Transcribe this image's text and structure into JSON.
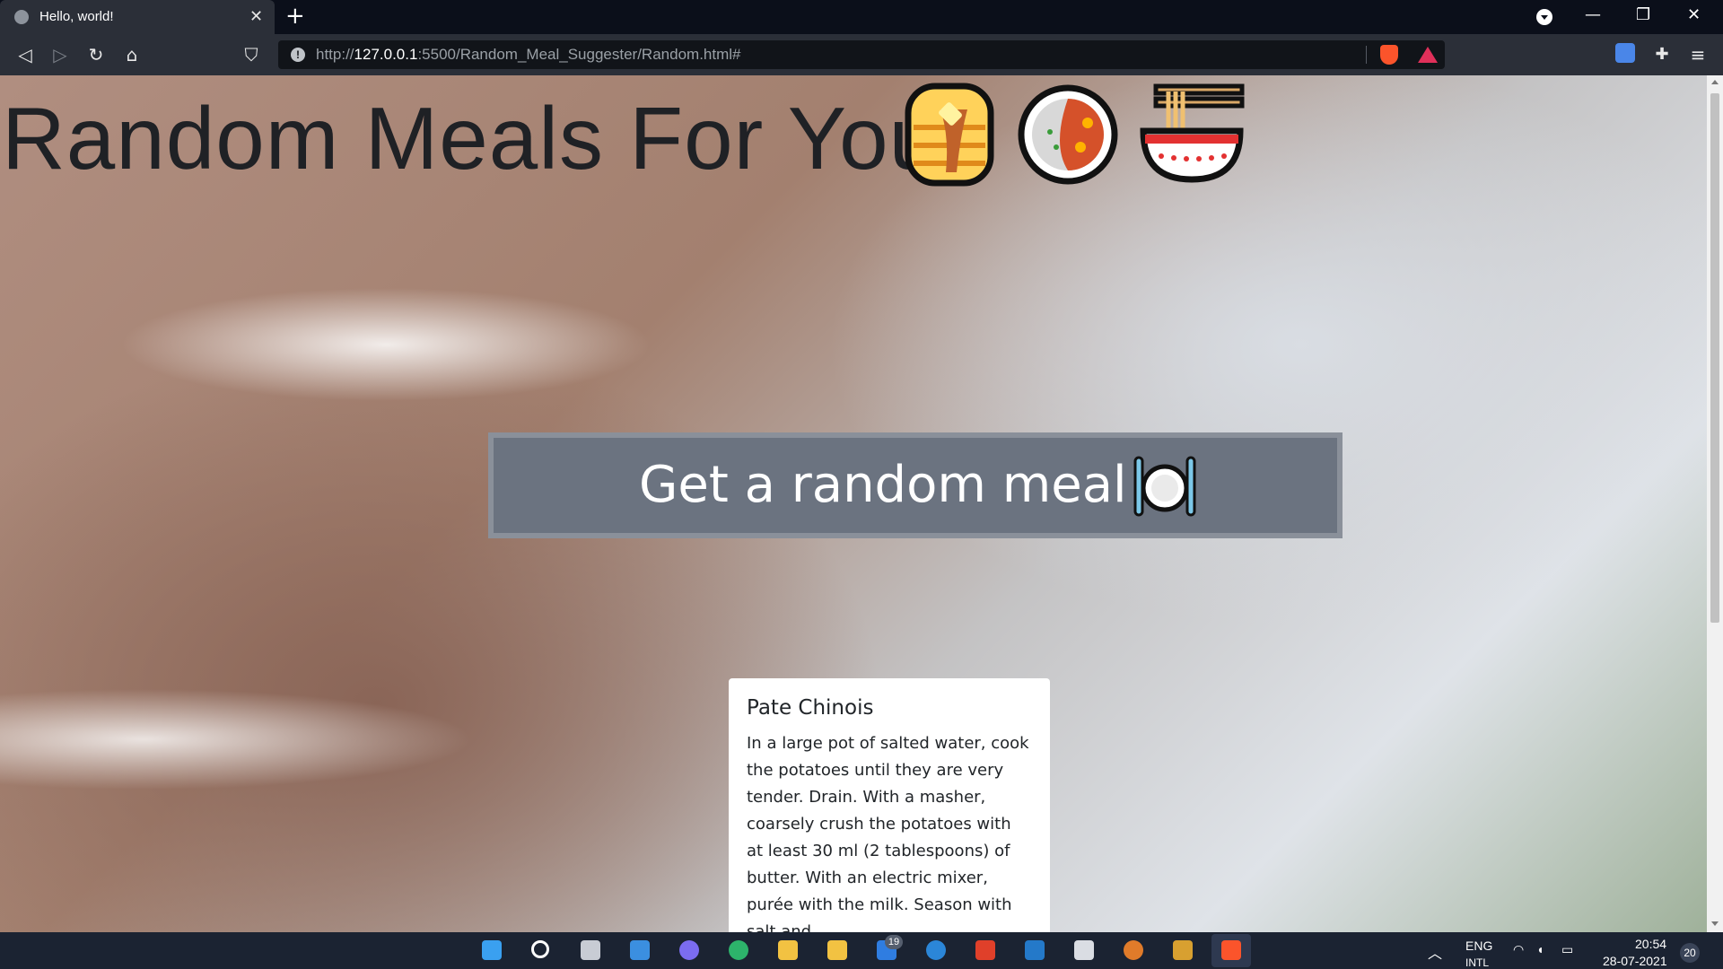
{
  "browser": {
    "tab": {
      "title": "Hello, world!",
      "close_glyph": "✕"
    },
    "new_tab_glyph": "+",
    "window_controls": {
      "minimize": "—",
      "restore": "❐",
      "close": "✕"
    },
    "nav": {
      "back": "◁",
      "forward": "▷",
      "reload": "↻",
      "home": "⌂",
      "bookmark": "⛉"
    },
    "url": {
      "scheme": "http://",
      "host": "127.0.0.1",
      "rest": ":5500/Random_Meal_Suggester/Random.html#"
    },
    "menu_glyph": "≡"
  },
  "page": {
    "headline": "Random Meals For You",
    "headline_emojis": [
      "pancakes-icon",
      "curry-rice-icon",
      "ramen-bowl-icon"
    ],
    "cta_label": "Get a random meal",
    "cta_icon": "plate-fork-knife-icon",
    "meal": {
      "title": "Pate Chinois",
      "instructions": "In a large pot of salted water, cook the potatoes until they are very tender. Drain. With a masher, coarsely crush the potatoes with at least 30 ml (2 tablespoons) of butter. With an electric mixer, purée with the milk. Season with salt and"
    }
  },
  "taskbar": {
    "mail_badge": "19",
    "language": "ENG",
    "language_sub": "INTL",
    "time": "20:54",
    "date": "28-07-2021",
    "notifications": "20"
  },
  "colors": {
    "accent": "#6b7380",
    "chrome": "#2b2f38",
    "taskbar": "#1b2332"
  }
}
